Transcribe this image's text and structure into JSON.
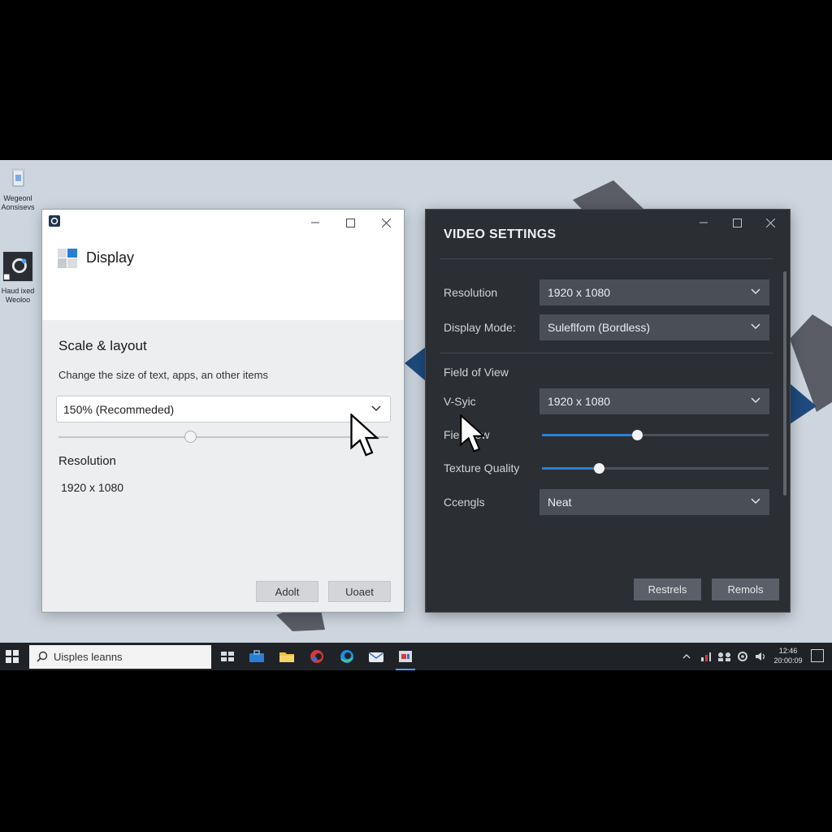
{
  "desktop": {
    "icons": [
      {
        "label": "Wegeonl Aonsisevs"
      },
      {
        "label": "Haud ixed Weoloo"
      }
    ]
  },
  "display_window": {
    "page_title": "Display",
    "section_title": "Scale & layout",
    "section_description": "Change the size of text, apps, an other items",
    "scale_selected": "150% (Recommeded)",
    "scale_slider_fraction": 0.4,
    "resolution_label": "Resolution",
    "resolution_value": "1920 x 1080",
    "buttons": {
      "primary": "Adolt",
      "secondary": "Uoaet"
    }
  },
  "video_window": {
    "title": "VIDEO SETTINGS",
    "rows": {
      "resolution": {
        "label": "Resolution",
        "value": "1920 x 1080"
      },
      "display_mode": {
        "label": "Display Mode:",
        "value": "Suleflfom (Bordless)"
      },
      "field_of_view_header": {
        "label": "Field of View"
      },
      "vsync": {
        "label": "V-Syic",
        "value": "1920 x 1080"
      },
      "field_of_view_slider": {
        "label": "Fiel View",
        "fraction": 0.42
      },
      "texture_quality": {
        "label": "Texture Quality",
        "fraction": 0.25
      },
      "cengls": {
        "label": "Ccengls",
        "value": "Neat"
      }
    },
    "buttons": {
      "primary": "Restrels",
      "secondary": "Remols"
    }
  },
  "taskbar": {
    "search_placeholder": "Uisples leanns",
    "apps": [
      "task-view-icon",
      "toolbox-icon",
      "folder-icon",
      "browser-icon",
      "edge-icon",
      "mail-icon",
      "settings-app-icon"
    ],
    "tray_time": "12:46",
    "tray_date": "20:00:09"
  },
  "colors": {
    "accent": "#2a7fd4",
    "dark_window": "#2b2e33",
    "light_window": "#eceef0"
  }
}
